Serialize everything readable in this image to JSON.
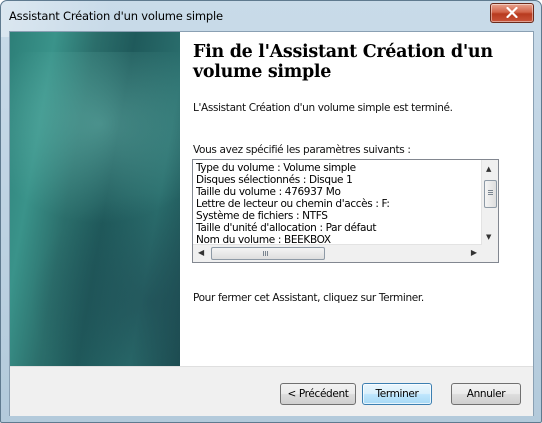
{
  "window": {
    "title": "Assistant Création d'un volume simple"
  },
  "wizard": {
    "heading": "Fin de l'Assistant Création d'un volume simple",
    "completed_text": "L'Assistant Création d'un volume simple est terminé.",
    "params_label": "Vous avez spécifié les paramètres suivants :",
    "params": [
      "Type du volume : Volume simple",
      "Disques sélectionnés : Disque 1",
      "Taille du volume : 476937 Mo",
      "Lettre de lecteur ou chemin d'accès : F:",
      "Système de fichiers : NTFS",
      "Taille d'unité d'allocation : Par défaut",
      "Nom du volume : BEEKBOX"
    ],
    "close_instruction": "Pour fermer cet Assistant, cliquez sur Terminer."
  },
  "buttons": {
    "previous": "< Précédent",
    "finish": "Terminer",
    "cancel": "Annuler"
  },
  "icons": {
    "close": "close-x-icon",
    "scroll_up": "scroll-up-arrow-icon",
    "scroll_down": "scroll-down-arrow-icon",
    "scroll_left": "scroll-left-arrow-icon",
    "scroll_right": "scroll-right-arrow-icon"
  }
}
